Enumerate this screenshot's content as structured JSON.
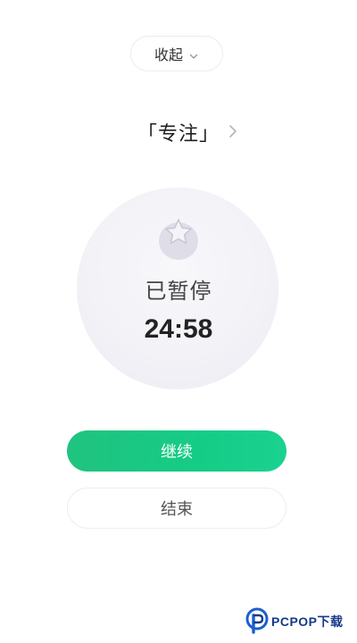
{
  "header": {
    "collapse_label": "收起"
  },
  "mode": {
    "title": "「专注」"
  },
  "timer": {
    "status": "已暂停",
    "remaining": "24:58"
  },
  "actions": {
    "continue_label": "继续",
    "end_label": "结束"
  },
  "watermark": {
    "text": "PCPOP下载"
  },
  "colors": {
    "accent": "#1cc985",
    "circle_bg": "#f2f2f7",
    "icon_bg": "#dcdce7",
    "text_primary": "#222222",
    "watermark": "#153a8a"
  },
  "icons": {
    "collapse": "chevron-down-icon",
    "mode_more": "chevron-right-icon",
    "timer": "tomato-star-icon",
    "watermark_logo": "pcpop-logo"
  }
}
